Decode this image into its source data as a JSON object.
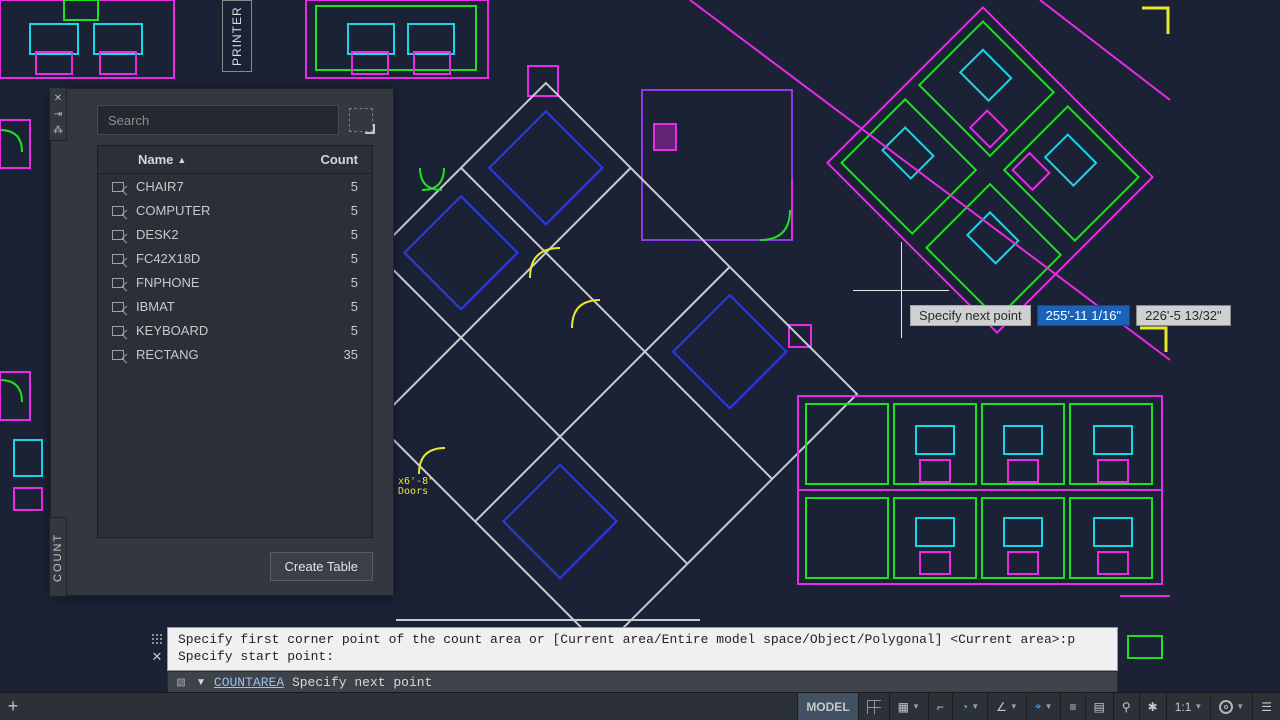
{
  "printer_label": "PRINTER",
  "palette": {
    "title": "COUNT",
    "search_placeholder": "Search",
    "columns": {
      "name": "Name",
      "count": "Count"
    },
    "create_button": "Create Table",
    "rows": [
      {
        "name": "CHAIR7",
        "count": "5"
      },
      {
        "name": "COMPUTER",
        "count": "5"
      },
      {
        "name": "DESK2",
        "count": "5"
      },
      {
        "name": "FC42X18D",
        "count": "5"
      },
      {
        "name": "FNPHONE",
        "count": "5"
      },
      {
        "name": "IBMAT",
        "count": "5"
      },
      {
        "name": "KEYBOARD",
        "count": "5"
      },
      {
        "name": "RECTANG",
        "count": "35"
      }
    ]
  },
  "tooltip": {
    "label": "Specify next point",
    "coord1": "255'-11 1/16\"",
    "coord2": "226'-5 13/32\""
  },
  "command": {
    "history1": "Specify first corner point of the count area or [Current area/Entire model space/Object/Polygonal] <Current area>:p",
    "history2": "Specify start point:",
    "name": "COUNTAREA",
    "prompt": "Specify next point"
  },
  "statusbar": {
    "model": "MODEL",
    "ratio": "1:1",
    "doors_note": "x6'-8\" Doors"
  },
  "colors": {
    "magenta": "#e72be7",
    "green": "#1fe01f",
    "cyan": "#17d7e6",
    "yellow": "#e7e72b",
    "blue": "#2b3be7",
    "white": "#c9cbd0",
    "purple": "#8d3be7"
  }
}
